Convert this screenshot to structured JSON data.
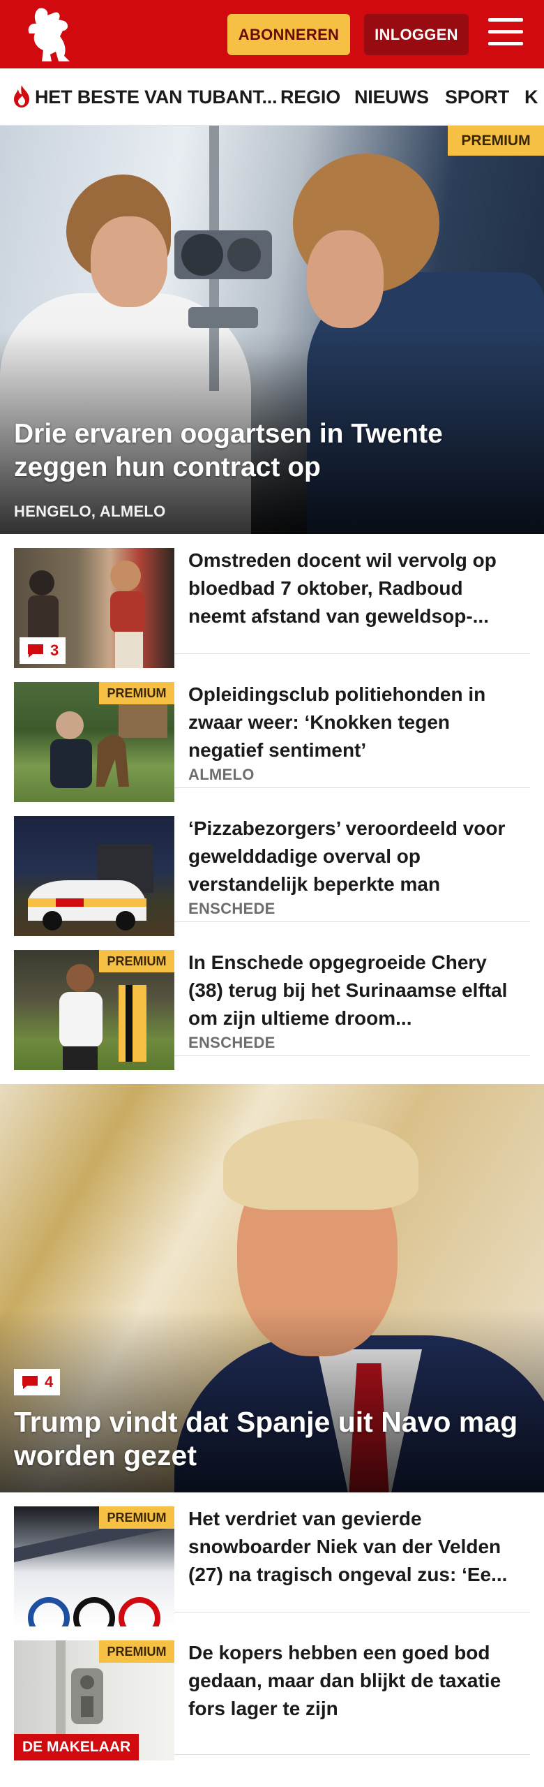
{
  "header": {
    "subscribe_label": "ABONNEREN",
    "login_label": "INLOGGEN",
    "brand_color": "#d10a10",
    "accent_color": "#f5c043"
  },
  "nav": {
    "items": [
      {
        "label": "HET BESTE VAN TUBANT...",
        "icon": "flame-icon"
      },
      {
        "label": "REGIO"
      },
      {
        "label": "NIEUWS"
      },
      {
        "label": "SPORT"
      },
      {
        "label": "K"
      }
    ]
  },
  "hero1": {
    "badge": "PREMIUM",
    "title": "Drie ervaren oogartsen in Twente zeggen hun contract op",
    "location": "HENGELO, ALMELO"
  },
  "articles": [
    {
      "title": "Omstreden docent wil vervolg op bloedbad 7 oktober, Radboud neemt afstand van geweldsop-...",
      "comments": "3"
    },
    {
      "title": "Opleidingsclub politiehonden in zwaar weer: ‘Knokken tegen negatief sentiment’",
      "badge": "PREMIUM",
      "location": "ALMELO"
    },
    {
      "title": "‘Pizzabezorgers’ veroordeeld voor gewelddadige overval op verstandelijk beperkte man",
      "location": "ENSCHEDE"
    },
    {
      "title": "In Enschede opgegroeide Chery (38) terug bij het Surinaamse elftal om zijn ultieme droom...",
      "badge": "PREMIUM",
      "location": "ENSCHEDE"
    }
  ],
  "hero2": {
    "title": "Trump vindt dat Spanje uit Navo mag worden gezet",
    "comments": "4"
  },
  "articles2": [
    {
      "title": "Het verdriet van gevierde snowboarder Niek van der Velden (27) na tragisch ongeval zus: ‘Ee...",
      "badge": "PREMIUM"
    },
    {
      "title": "De kopers hebben een goed bod gedaan, maar dan blijkt de taxatie fors lager te zijn",
      "badge": "PREMIUM",
      "brand": "DE MAKELAAR"
    }
  ]
}
